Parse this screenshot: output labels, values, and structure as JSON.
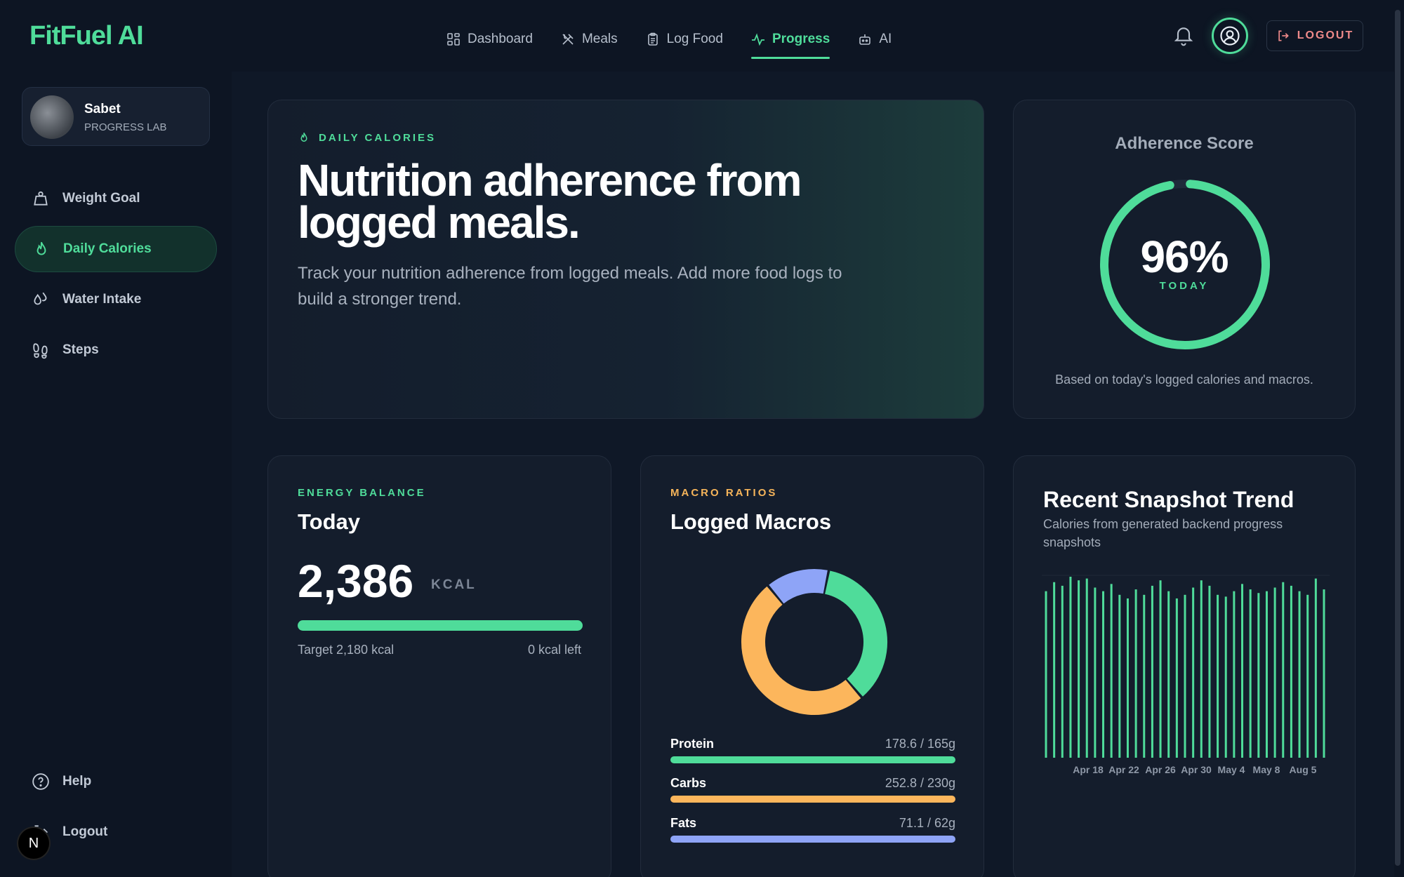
{
  "brand": "FitFuel AI",
  "nav": [
    {
      "label": "Dashboard",
      "icon": "grid-icon"
    },
    {
      "label": "Meals",
      "icon": "utensils-icon"
    },
    {
      "label": "Log Food",
      "icon": "clipboard-icon"
    },
    {
      "label": "Progress",
      "icon": "activity-icon",
      "active": true
    },
    {
      "label": "AI",
      "icon": "robot-icon"
    }
  ],
  "header": {
    "logout_label": "LOGOUT"
  },
  "profile": {
    "name": "Sabet",
    "role": "PROGRESS LAB"
  },
  "sidebar": {
    "items": [
      {
        "label": "Weight Goal",
        "icon": "weight-icon"
      },
      {
        "label": "Daily Calories",
        "icon": "flame-icon",
        "active": true
      },
      {
        "label": "Water Intake",
        "icon": "droplets-icon"
      },
      {
        "label": "Steps",
        "icon": "footprints-icon"
      }
    ],
    "help_label": "Help",
    "logout_label": "Logout"
  },
  "dev_badge": "N",
  "hero": {
    "eyebrow": "DAILY CALORIES",
    "title": "Nutrition adherence from logged meals.",
    "description": "Track your nutrition adherence from logged meals. Add more food logs to build a stronger trend."
  },
  "adherence": {
    "title": "Adherence Score",
    "value": "96%",
    "fraction": 0.96,
    "caption": "TODAY",
    "note": "Based on today's logged calories and macros."
  },
  "energy": {
    "eyebrow": "ENERGY BALANCE",
    "title": "Today",
    "value": "2,386",
    "unit": "KCAL",
    "fill_fraction": 1.0,
    "target": "Target 2,180 kcal",
    "left": "0 kcal left"
  },
  "macros": {
    "eyebrow": "MACRO RATIOS",
    "title": "Logged Macros",
    "items": [
      {
        "label": "Protein",
        "value": "178.6 / 165g",
        "grams": 178.6,
        "color": "#4fdc9a"
      },
      {
        "label": "Carbs",
        "value": "252.8 / 230g",
        "grams": 252.8,
        "color": "#fcb65c"
      },
      {
        "label": "Fats",
        "value": "71.1 / 62g",
        "grams": 71.1,
        "color": "#8ea4f7"
      }
    ]
  },
  "trend": {
    "title": "Recent Snapshot Trend",
    "subtitle": "Calories from generated backend progress snapshots"
  },
  "chart_data": {
    "type": "bar",
    "x_tick_labels": [
      "Apr 18",
      "Apr 22",
      "Apr 26",
      "Apr 30",
      "May 4",
      "May 8",
      "Aug 5"
    ],
    "values": [
      0.92,
      0.97,
      0.95,
      1.0,
      0.98,
      0.99,
      0.94,
      0.92,
      0.96,
      0.9,
      0.88,
      0.93,
      0.9,
      0.95,
      0.98,
      0.92,
      0.88,
      0.9,
      0.94,
      0.98,
      0.95,
      0.9,
      0.89,
      0.92,
      0.96,
      0.93,
      0.91,
      0.92,
      0.94,
      0.97,
      0.95,
      0.92,
      0.9,
      0.99,
      0.93
    ],
    "value_scale": "relative",
    "color": "#4fdc9a",
    "grid": false
  },
  "colors": {
    "accent": "#4fdc9a",
    "carbs": "#fcb65c",
    "fats": "#8ea4f7",
    "danger": "#ef8a8a"
  }
}
